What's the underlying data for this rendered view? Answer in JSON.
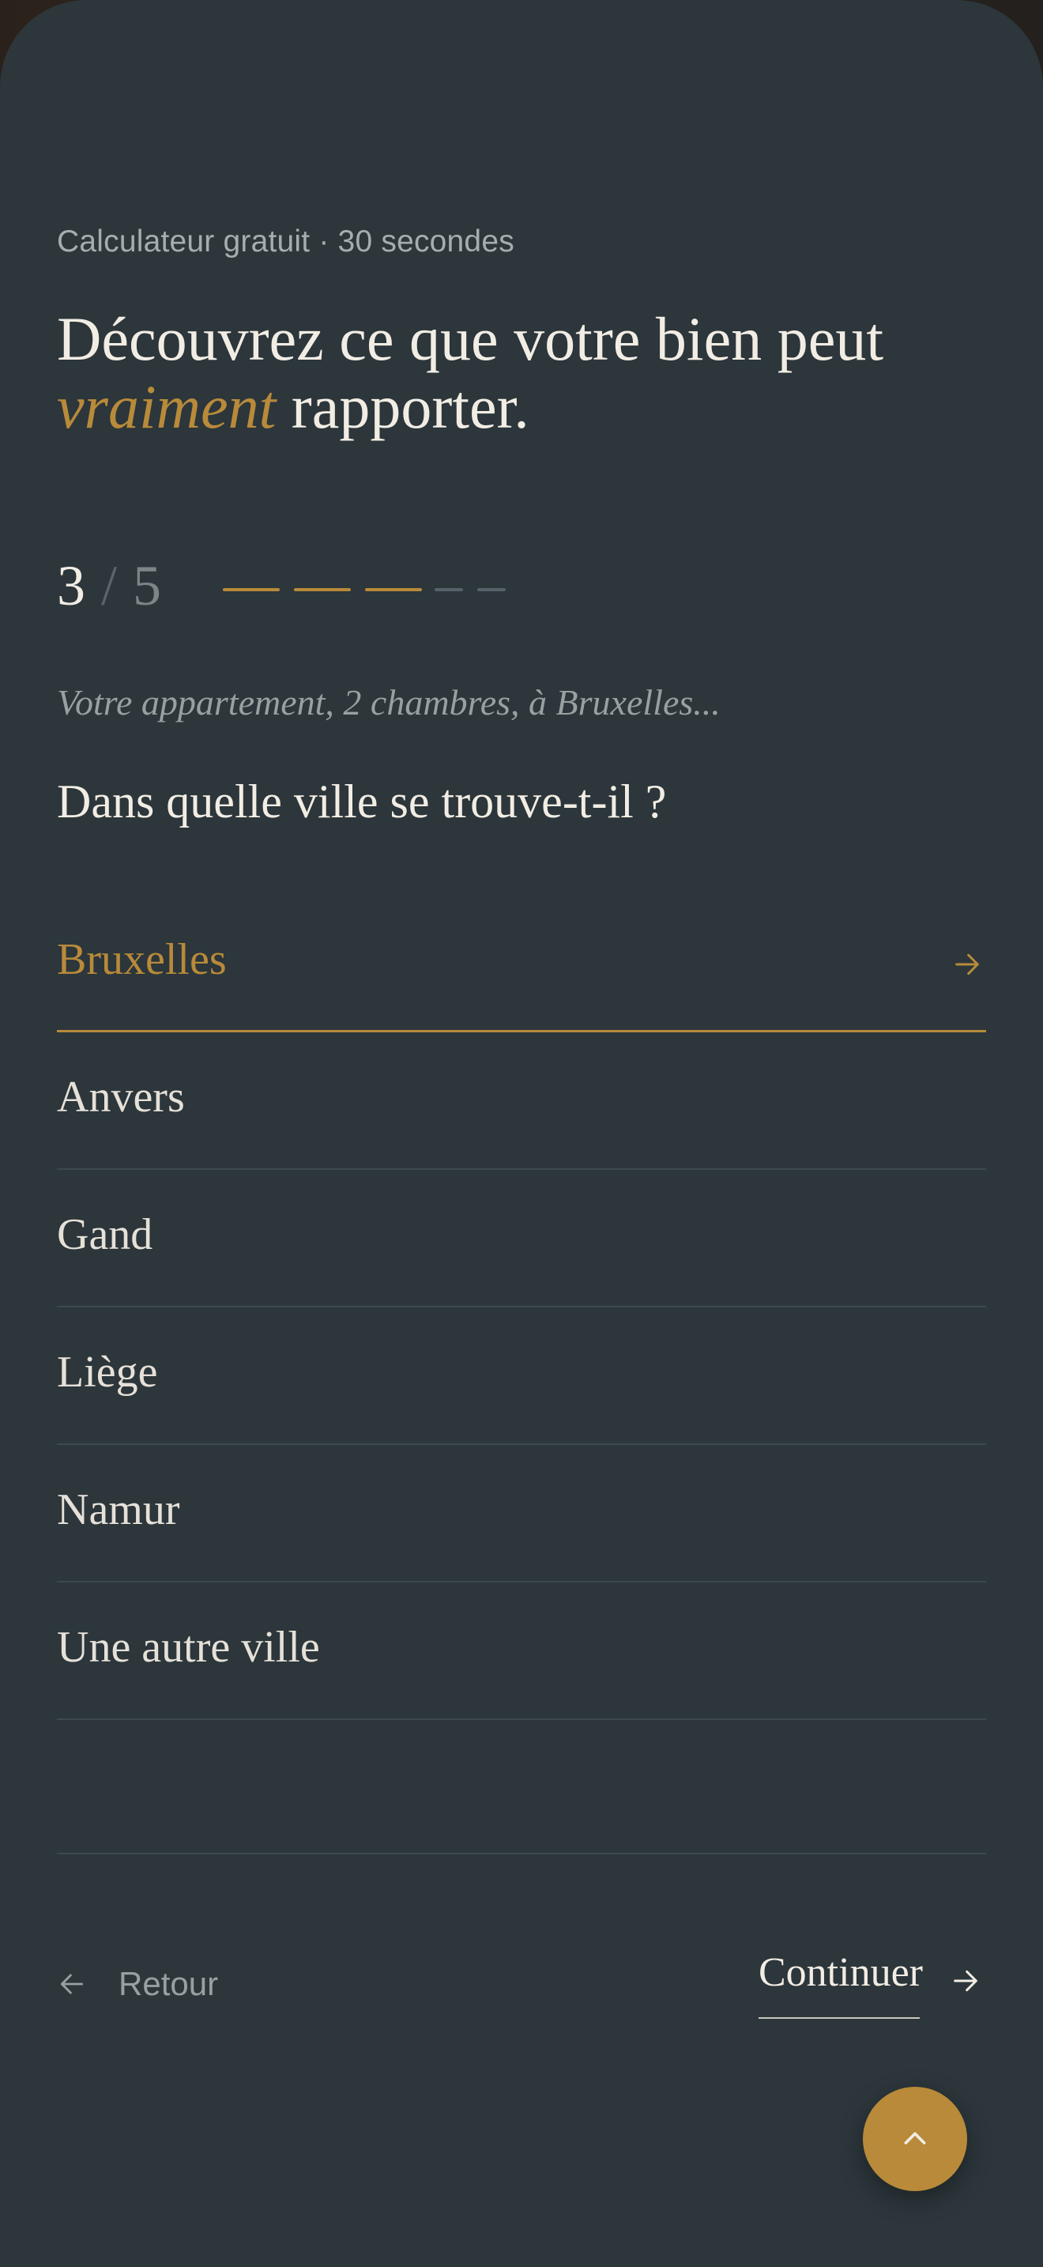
{
  "header": {
    "eyebrow": "Calculateur gratuit · 30 secondes",
    "headline_part1": "Découvrez ce que votre bien peut",
    "headline_accent": "vraiment",
    "headline_part2": "rapporter."
  },
  "progress": {
    "current": "3",
    "separator": "/",
    "total": "5",
    "steps_completed": 3,
    "steps_total": 5
  },
  "question": {
    "context": "Votre appartement, 2 chambres, à Bruxelles...",
    "title": "Dans quelle ville se trouve-t-il ?"
  },
  "options": [
    {
      "label": "Bruxelles",
      "selected": true
    },
    {
      "label": "Anvers",
      "selected": false
    },
    {
      "label": "Gand",
      "selected": false
    },
    {
      "label": "Liège",
      "selected": false
    },
    {
      "label": "Namur",
      "selected": false
    },
    {
      "label": "Une autre ville",
      "selected": false
    }
  ],
  "nav": {
    "back_label": "Retour",
    "continue_label": "Continuer"
  },
  "icons": {
    "option_arrow": "arrow-right-icon",
    "back": "arrow-left-icon",
    "continue": "arrow-right-icon",
    "scroll_top": "chevron-up-icon"
  },
  "colors": {
    "background": "#2c363b",
    "accent": "#b88a3a",
    "text": "#f2ede4",
    "muted": "#9aa0a1"
  }
}
